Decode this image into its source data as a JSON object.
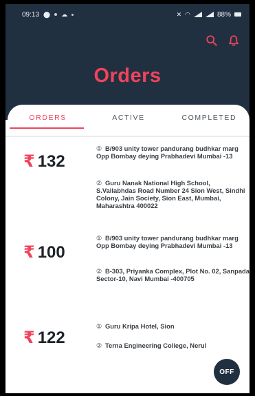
{
  "status_bar": {
    "time": "09:13",
    "battery": "88%"
  },
  "header": {
    "title": "Orders",
    "accent": "#f0445c",
    "background": "#213040",
    "icons": [
      "search-icon",
      "bell-icon"
    ]
  },
  "tabs": [
    {
      "label": "ORDERS",
      "active": true
    },
    {
      "label": "ACTIVE",
      "active": false
    },
    {
      "label": "COMPLETED",
      "active": false
    }
  ],
  "orders": [
    {
      "currency": "₹",
      "amount": "132",
      "pickup_index": "①",
      "pickup": "B/903 unity tower pandurang budhkar marg Opp Bombay deying Prabhadevi Mumbai -13",
      "drop_index": "②",
      "drop": "Guru Nanak National High School, S.Vallabhdas Road Number 24 Sion West, Sindhi Colony, Jain Society, Sion East, Mumbai, Maharashtra 400022"
    },
    {
      "currency": "₹",
      "amount": "100",
      "pickup_index": "①",
      "pickup": "B/903 unity tower pandurang budhkar marg Opp Bombay deying Prabhadevi Mumbai -13",
      "drop_index": "②",
      "drop": "B-303, Priyanka Complex, Plot No. 02, Sanpada Sector-10, Navi Mumbai -400705"
    },
    {
      "currency": "₹",
      "amount": "122",
      "pickup_index": "①",
      "pickup": "Guru Kripa Hotel, Sion",
      "drop_index": "②",
      "drop": "Terna Engineering College, Nerul"
    }
  ],
  "fab": {
    "label": "OFF"
  }
}
